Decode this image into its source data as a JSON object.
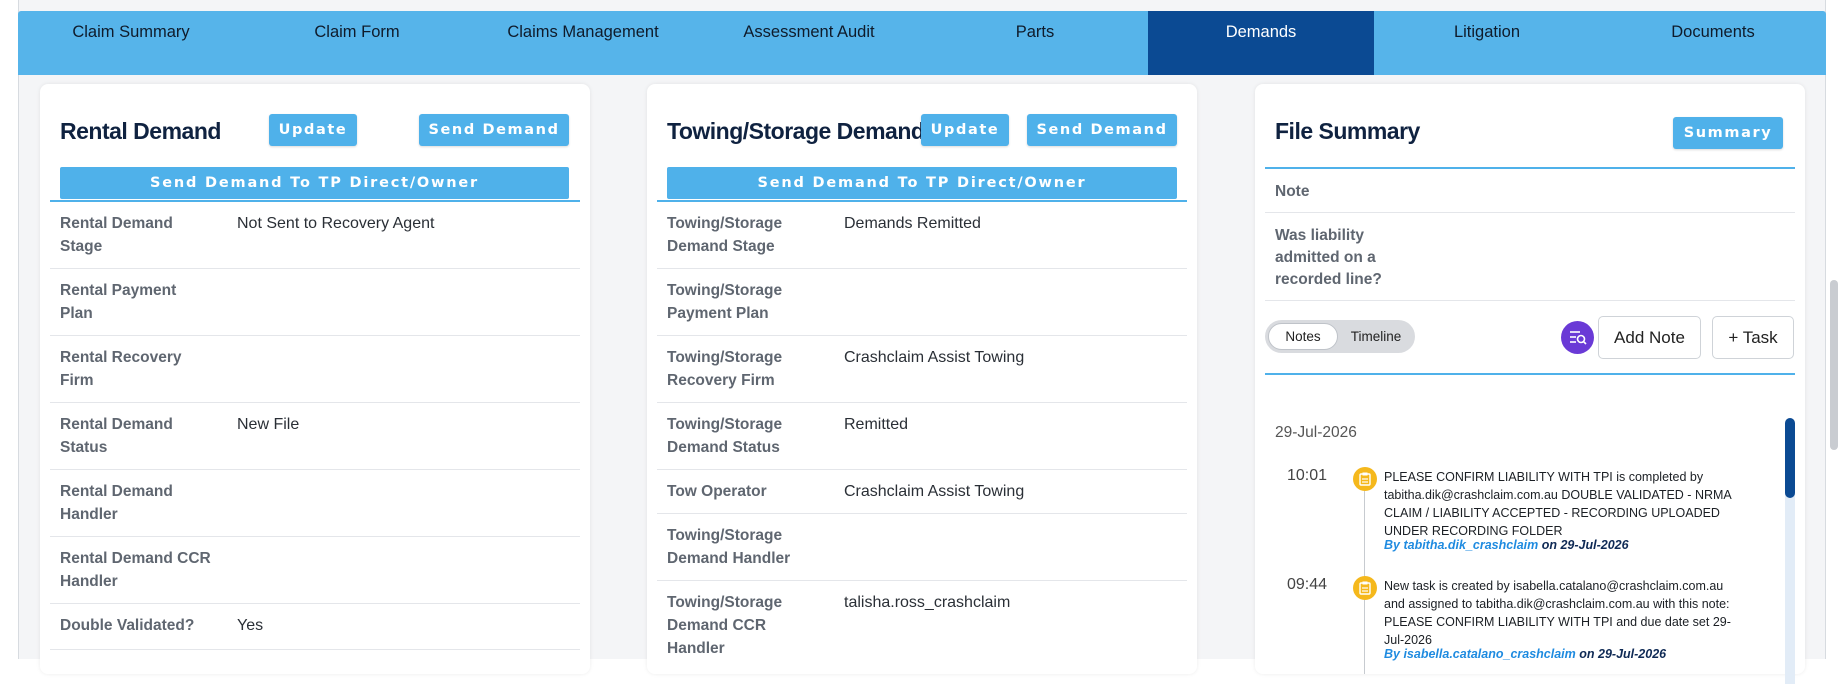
{
  "tabs": [
    {
      "label": "Claim Summary"
    },
    {
      "label": "Claim Form"
    },
    {
      "label": "Claims Management"
    },
    {
      "label": "Assessment Audit"
    },
    {
      "label": "Parts"
    },
    {
      "label": "Demands"
    },
    {
      "label": "Litigation"
    },
    {
      "label": "Documents"
    }
  ],
  "rental": {
    "title": "Rental Demand",
    "update_label": "Update",
    "send_label": "Send Demand",
    "tp_label": "Send Demand To TP Direct/Owner",
    "rows": [
      {
        "label": "Rental Demand Stage",
        "value": "Not Sent to Recovery Agent"
      },
      {
        "label": "Rental Payment Plan",
        "value": ""
      },
      {
        "label": "Rental Recovery Firm",
        "value": ""
      },
      {
        "label": "Rental Demand Status",
        "value": "New File"
      },
      {
        "label": "Rental Demand Handler",
        "value": ""
      },
      {
        "label": "Rental Demand CCR Handler",
        "value": ""
      },
      {
        "label": "Double Validated?",
        "value": "Yes"
      }
    ]
  },
  "towing": {
    "title": "Towing/Storage Demand",
    "update_label": "Update",
    "send_label": "Send Demand",
    "tp_label": "Send Demand To TP Direct/Owner",
    "rows": [
      {
        "label": "Towing/Storage Demand Stage",
        "value": "Demands Remitted"
      },
      {
        "label": "Towing/Storage Payment Plan",
        "value": ""
      },
      {
        "label": "Towing/Storage Recovery Firm",
        "value": "Crashclaim Assist Towing"
      },
      {
        "label": "Towing/Storage Demand Status",
        "value": "Remitted"
      },
      {
        "label": "Tow Operator",
        "value": "Crashclaim Assist Towing"
      },
      {
        "label": "Towing/Storage Demand Handler",
        "value": ""
      },
      {
        "label": "Towing/Storage Demand CCR Handler",
        "value": "talisha.ross_crashclaim"
      }
    ]
  },
  "file_summary": {
    "title": "File Summary",
    "summary_label": "Summary",
    "note_label": "Note",
    "liability_label": "Was liability admitted on a recorded line?",
    "toggle_notes": "Notes",
    "toggle_timeline": "Timeline",
    "add_note_label": "Add Note",
    "task_label": "+ Task",
    "date": "29-Jul-2026",
    "notes": [
      {
        "time": "10:01",
        "text": "PLEASE CONFIRM LIABILITY WITH TPI is completed by tabitha.dik@crashclaim.com.au DOUBLE VALIDATED - NRMA CLAIM / LIABILITY ACCEPTED - RECORDING UPLOADED UNDER RECORDING FOLDER",
        "by": "By tabitha.dik_crashclaim",
        "on": "on 29-Jul-2026"
      },
      {
        "time": "09:44",
        "text": "New task is created by isabella.catalano@crashclaim.com.au and assigned to tabitha.dik@crashclaim.com.au with this note: PLEASE CONFIRM LIABILITY WITH TPI and due date set 29-Jul-2026",
        "by": "By isabella.catalano_crashclaim",
        "on": "on 29-Jul-2026"
      }
    ]
  },
  "colors": {
    "tab_bar": "#56b4ea",
    "tab_active": "#0b4a93",
    "button": "#4fb1ea",
    "note_icon": "#f5b81c",
    "search_icon_bg": "#6a3ad6"
  }
}
